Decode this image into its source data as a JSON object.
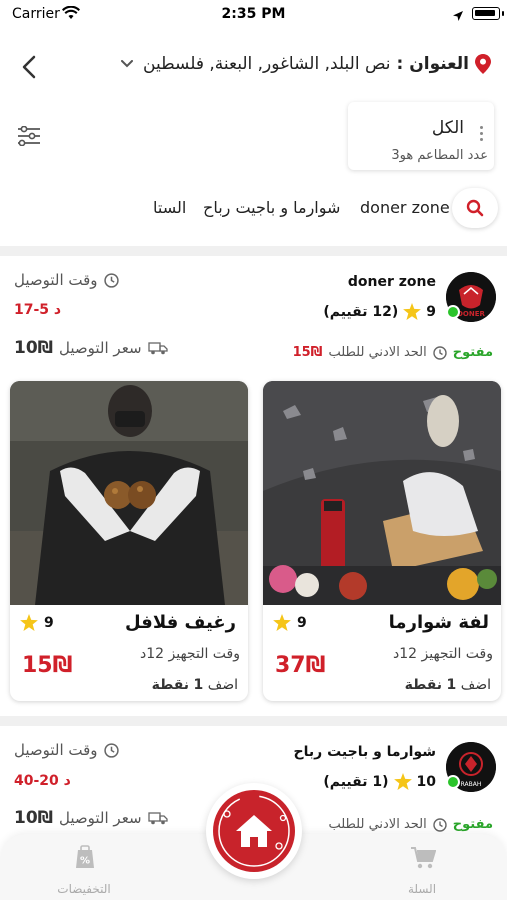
{
  "status": {
    "carrier": "Carrier",
    "time": "2:35 PM"
  },
  "header": {
    "address_label": "العنوان :",
    "address_value": "نص البلد, الشاغور, البعنة, فلسطين"
  },
  "filter": {
    "title": "الكل",
    "subtitle": "عدد المطاعم هو3"
  },
  "quick_categories": [
    "doner zone",
    "شوارما و باجيت رباح",
    "الستا"
  ],
  "restaurants": [
    {
      "name": "doner zone",
      "rating": "9",
      "reviews": "(12 تقييم)",
      "status": "مفتوح",
      "min_order_label": "الحد الادني للطلب",
      "min_order_value": "15₪",
      "delivery_time_label": "وقت التوصيل",
      "delivery_time_value": "17-5 د",
      "delivery_fee_label": "سعر التوصيل",
      "delivery_fee_value": "10₪",
      "products": [
        {
          "name": "لفة شوارما",
          "rating": "9",
          "prep": "وقت التجهيز  12د",
          "price": "37₪",
          "points_prefix": "اضف",
          "points_num": "1",
          "points_suffix": "نقطة"
        },
        {
          "name": "رغيف فلافل",
          "rating": "9",
          "prep": "وقت التجهيز  12د",
          "price": "15₪",
          "points_prefix": "اضف",
          "points_num": "1",
          "points_suffix": "نقطة"
        }
      ]
    },
    {
      "name": "شوارما و باجيت رباح",
      "rating": "10",
      "reviews": "(1 تقييم)",
      "status": "مفتوح",
      "min_order_label": "الحد الادني للطلب",
      "delivery_time_label": "وقت التوصيل",
      "delivery_time_value": "40-20 د",
      "delivery_fee_label": "سعر التوصيل",
      "delivery_fee_value": "10₪"
    }
  ],
  "tabs": {
    "offers": "التخفيضات",
    "cart": "السلة"
  },
  "colors": {
    "brand": "#c8232b",
    "open": "#2aa52a",
    "star": "#f5c518"
  }
}
